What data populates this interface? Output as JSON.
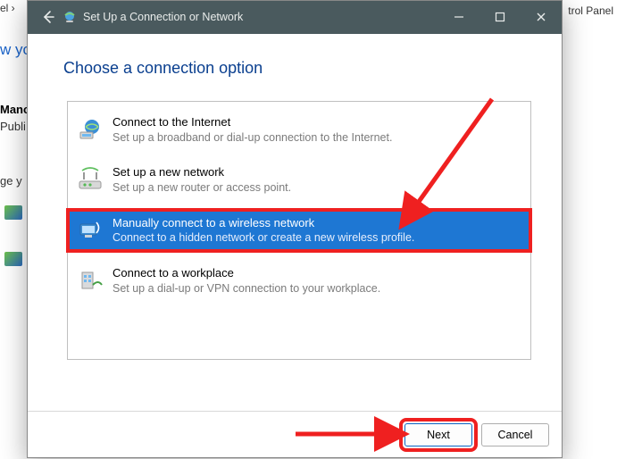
{
  "background": {
    "crumb": "el  ›",
    "top_right": "trol Panel",
    "blue_link": "w yo",
    "manc": "Manc",
    "publi": "Publi",
    "geyx": "ge y"
  },
  "dialog": {
    "title": "Set Up a Connection or Network",
    "heading": "Choose a connection option",
    "options": [
      {
        "id": "internet",
        "title": "Connect to the Internet",
        "desc": "Set up a broadband or dial-up connection to the Internet.",
        "selected": false
      },
      {
        "id": "new-network",
        "title": "Set up a new network",
        "desc": "Set up a new router or access point.",
        "selected": false
      },
      {
        "id": "manual-wireless",
        "title": "Manually connect to a wireless network",
        "desc": "Connect to a hidden network or create a new wireless profile.",
        "selected": true,
        "highlighted": true
      },
      {
        "id": "workplace",
        "title": "Connect to a workplace",
        "desc": "Set up a dial-up or VPN connection to your workplace.",
        "selected": false
      }
    ],
    "buttons": {
      "next": "Next",
      "cancel": "Cancel"
    }
  }
}
